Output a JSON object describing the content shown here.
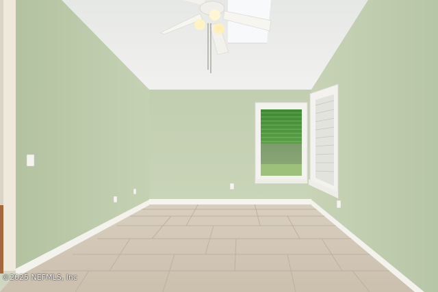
{
  "photo": {
    "watermark": "©2025 NEFMLS, Inc",
    "palette": {
      "wall": "#c5d1b4",
      "ceiling": "#ecedec",
      "floor": "#d2c6b5",
      "trim": "#f7f6f1",
      "greenery": "#4e9a3c"
    }
  }
}
